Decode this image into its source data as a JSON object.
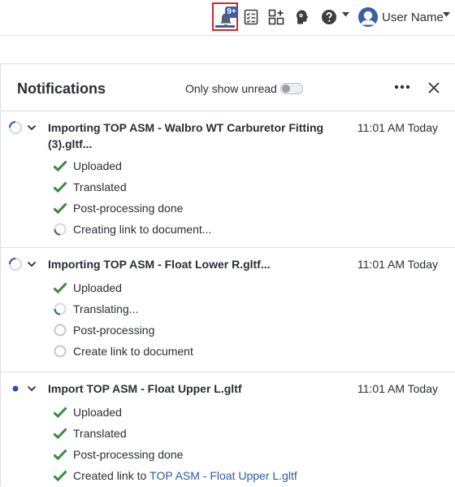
{
  "topbar": {
    "bell_badge": "9+",
    "user_name": "User Name",
    "icons": [
      "bell-icon",
      "tasks-icon",
      "apps-icon",
      "learning-icon",
      "help-icon",
      "avatar"
    ],
    "accent": "#3c5fa8",
    "highlight": "#d9232e"
  },
  "panel": {
    "title": "Notifications",
    "only_unread_label": "Only show unread",
    "only_unread_on": false
  },
  "notifications": [
    {
      "state": "in-progress",
      "title": "Importing TOP ASM - Walbro WT Carburetor Fitting (3).gltf...",
      "time": "11:01 AM Today",
      "steps": [
        {
          "status": "done",
          "label": "Uploaded"
        },
        {
          "status": "done",
          "label": "Translated"
        },
        {
          "status": "done",
          "label": "Post-processing done"
        },
        {
          "status": "in-progress",
          "label": "Creating link to document..."
        }
      ]
    },
    {
      "state": "in-progress",
      "title": "Importing TOP ASM - Float Lower R.gltf...",
      "time": "11:01 AM Today",
      "steps": [
        {
          "status": "done",
          "label": "Uploaded"
        },
        {
          "status": "in-progress",
          "label": "Translating..."
        },
        {
          "status": "pending",
          "label": "Post-processing"
        },
        {
          "status": "pending",
          "label": "Create link to document"
        }
      ]
    },
    {
      "state": "unread",
      "title": "Import TOP ASM - Float Upper L.gltf",
      "time": "11:01 AM Today",
      "steps": [
        {
          "status": "done",
          "label": "Uploaded"
        },
        {
          "status": "done",
          "label": "Translated"
        },
        {
          "status": "done",
          "label": "Post-processing done"
        },
        {
          "status": "done",
          "label": "Created link to ",
          "link": "TOP ASM - Float Upper L.gltf"
        }
      ]
    }
  ],
  "colors": {
    "check": "#3a8a3e",
    "spinner": "#3c5fa8",
    "pending": "#b8bcc2",
    "link": "#2b5aa5"
  }
}
